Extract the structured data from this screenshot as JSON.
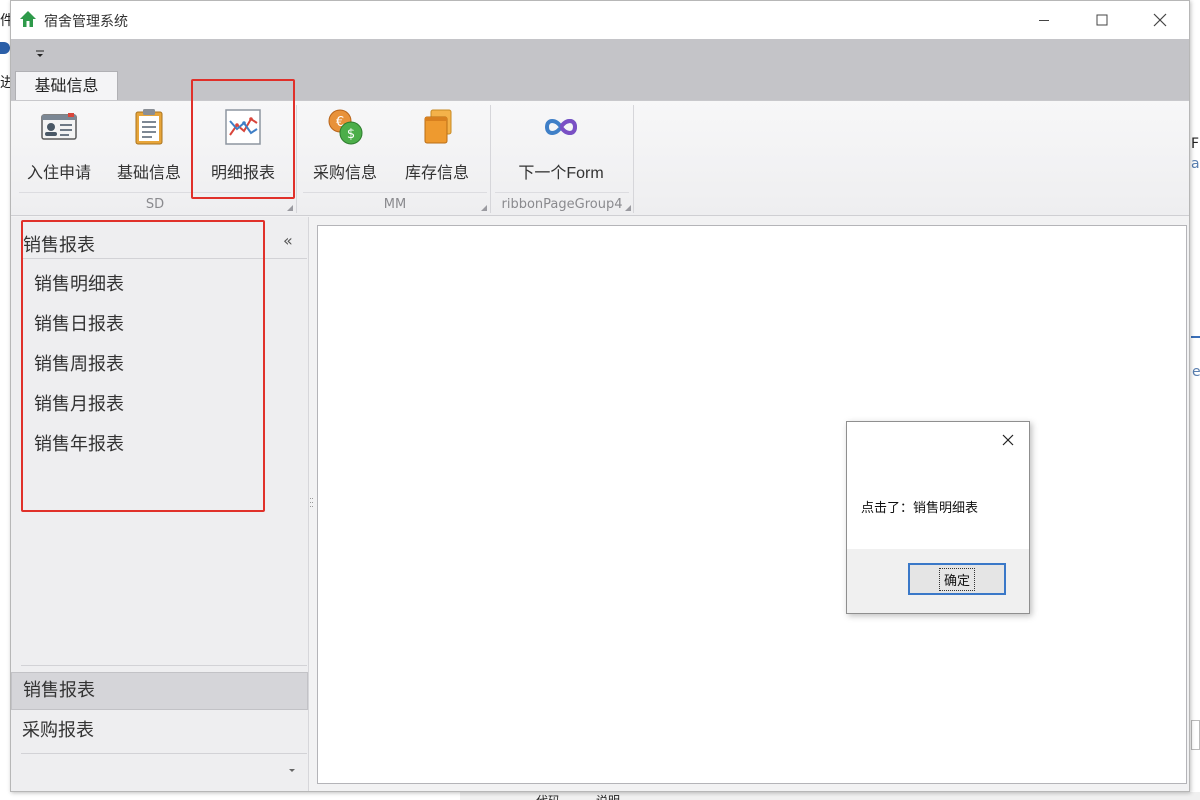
{
  "background": {
    "fragments": [
      "件",
      "进",
      "F",
      "as",
      "e",
      "代码",
      "说明"
    ]
  },
  "window": {
    "title": "宿舍管理系统",
    "ribbon": {
      "tab": "基础信息",
      "groups": [
        {
          "label": "SD",
          "buttons": [
            "入住申请",
            "基础信息",
            "明细报表"
          ]
        },
        {
          "label": "MM",
          "buttons": [
            "采购信息",
            "库存信息"
          ]
        },
        {
          "label": "ribbonPageGroup4",
          "buttons": [
            "下一个Form"
          ]
        }
      ]
    },
    "nav": {
      "header": "销售报表",
      "collapse_glyph": "«",
      "items": [
        "销售明细表",
        "销售日报表",
        "销售周报表",
        "销售月报表",
        "销售年报表"
      ],
      "groups": [
        "销售报表",
        "采购报表"
      ]
    }
  },
  "message_box": {
    "text": "点击了：销售明细表",
    "ok_label": "确定"
  },
  "colors": {
    "annotation": "#e0302a",
    "qat_background": "#c4c4c8",
    "ok_focus_border": "#3a78c8"
  }
}
